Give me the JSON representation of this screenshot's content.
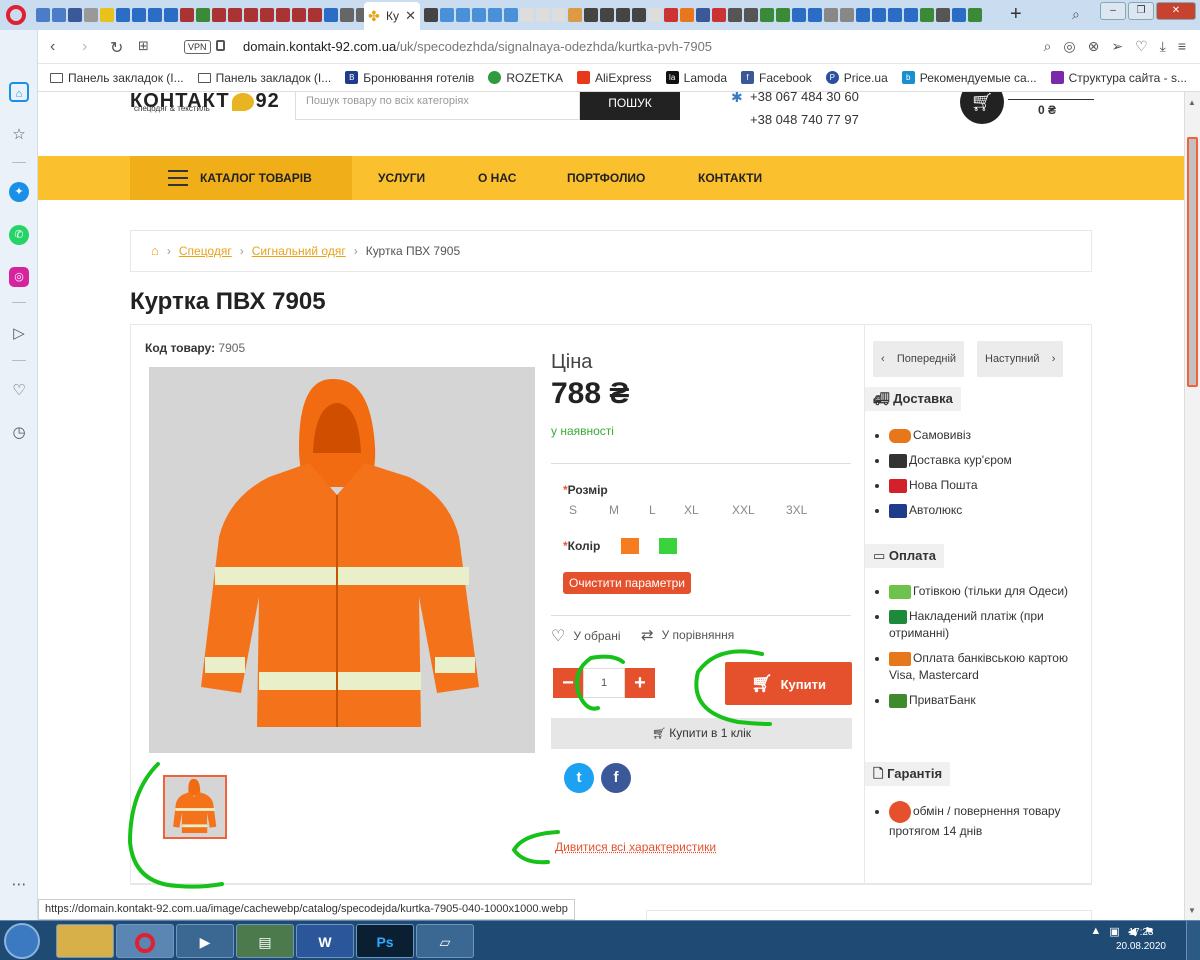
{
  "browser": {
    "active_tab_label": "Ку",
    "url_domain": "domain.kontakt-92.com.ua",
    "url_path": "/uk/specodezhda/signalnaya-odezhda/kurtka-pvh-7905",
    "vpn_label": "VPN",
    "bookmarks": [
      "Панель закладок (I...",
      "Панель закладок (I...",
      "Бронювання готелів",
      "ROZETKA",
      "AliExpress",
      "Lamoda",
      "Facebook",
      "Price.ua",
      "Рекомендуемые са...",
      "Структура сайта - s..."
    ],
    "status_url": "https://domain.kontakt-92.com.ua/image/cachewebp/catalog/specodejda/kurtka-7905-040-1000x1000.webp"
  },
  "header": {
    "logo_text": "КОНТАКТ",
    "logo_number": "92",
    "logo_sub": "спецодяг & текстиль",
    "search_placeholder": "Пошук товару по всіх категоріях",
    "search_button": "ПОШУК",
    "phone1": "+38 067 484 30 60",
    "phone2": "+38 048 740 77 97",
    "cart_total": "0 ₴"
  },
  "menu": {
    "catalog": "КАТАЛОГ ТОВАРІВ",
    "items": [
      "УСЛУГИ",
      "О НАС",
      "ПОРТФОЛИО",
      "КОНТАКТИ"
    ]
  },
  "breadcrumb": {
    "items": [
      "Спецодяг",
      "Сигнальний одяг"
    ],
    "current": "Куртка ПВХ 7905"
  },
  "product": {
    "title": "Куртка ПВХ 7905",
    "code_label": "Код товару:",
    "code_value": "7905",
    "price_label": "Ціна",
    "price": "788 ₴",
    "stock": "у наявності",
    "size_label": "Розмір",
    "sizes": [
      "S",
      "M",
      "L",
      "XL",
      "XXL",
      "3XL"
    ],
    "color_label": "Колір",
    "colors": [
      "#f57c1f",
      "#3bd33b"
    ],
    "clear_button": "Очистити параметри",
    "wishlist": "У обрані",
    "compare": "У порівняння",
    "quantity": "1",
    "buy_button": "Купити",
    "buy_one_click": "Купити в 1 клік",
    "all_specs": "Дивитися всі характеристики"
  },
  "sidebar": {
    "prev": "Попередній",
    "next": "Наступний",
    "delivery_title": "Доставка",
    "delivery": [
      "Самовивіз",
      "Доставка кур'єром",
      "Нова Пошта",
      "Автолюкс"
    ],
    "payment_title": "Оплата",
    "payment": [
      "Готівкою (тільки для Одеси)",
      "Накладений платіж (при отриманні)",
      "Оплата банківською картою Visa, Mastercard",
      "ПриватБанк"
    ],
    "warranty_title": "Гарантія",
    "warranty": [
      "обмін / повернення товару протягом 14 днів"
    ]
  },
  "taskbar": {
    "time": "17:28",
    "date": "20.08.2020"
  },
  "colors": {
    "accent": "#e5512d",
    "menu_bg": "#fbc02d",
    "annotation": "#17c11a"
  }
}
